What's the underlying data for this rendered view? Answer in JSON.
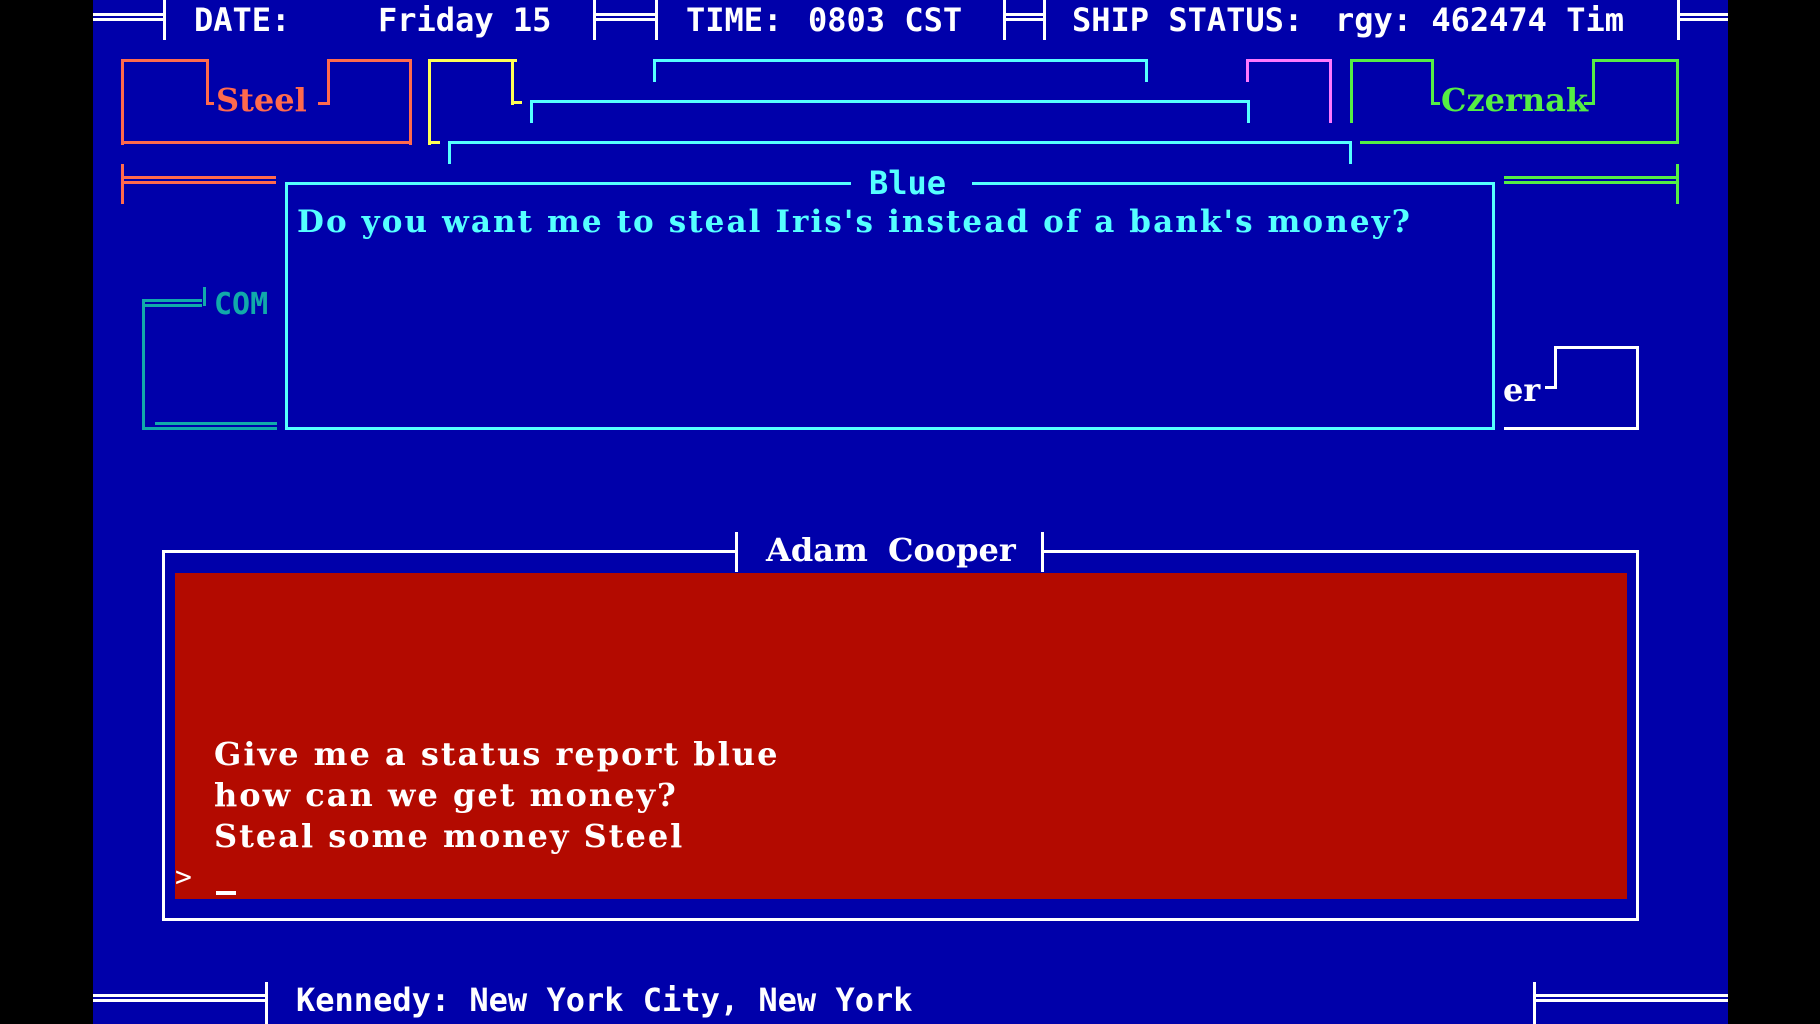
{
  "top_bar": {
    "date_label": "DATE:",
    "date_value": "Friday 15",
    "time_label": "TIME:",
    "time_value": "0803 CST",
    "ship_status_label": "SHIP STATUS:",
    "ship_status_value": "rgy: 462474 Tim"
  },
  "crew_tabs": [
    {
      "name": "Steel",
      "color": "#ff6a4d"
    },
    {
      "name": "Czernak",
      "color": "#55ee44"
    },
    {
      "name": "COM",
      "color": "#11aaaa"
    },
    {
      "name": "er",
      "color": "#ffffff"
    }
  ],
  "dialog": {
    "speaker": "Blue",
    "message": "Do you want me to steal Iris's instead of a bank's money?",
    "color": "#55ffff"
  },
  "console": {
    "title_first": "Adam",
    "title_last": "Cooper",
    "history": [
      "Give me a status report blue",
      "how can we get money?",
      "Steal some money Steel"
    ],
    "prompt": ">",
    "input_value": "",
    "cursor": "_",
    "background": "#b30a00"
  },
  "bottom_bar": {
    "location": "Kennedy: New York City, New York"
  },
  "colors": {
    "screen_bg": "#0000aa"
  }
}
